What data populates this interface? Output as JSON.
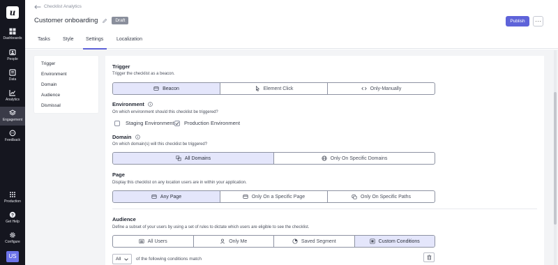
{
  "sidebar": {
    "logo": "u",
    "items": [
      {
        "label": "Dashboards",
        "icon": "dashboard-grid-icon"
      },
      {
        "label": "People",
        "icon": "people-icon"
      },
      {
        "label": "Data",
        "icon": "data-icon"
      },
      {
        "label": "Analytics",
        "icon": "analytics-chart-icon"
      },
      {
        "label": "Engagement",
        "icon": "engagement-layers-icon"
      },
      {
        "label": "Feedback",
        "icon": "feedback-chat-icon"
      },
      {
        "label": "Production",
        "icon": "production-grid-icon"
      },
      {
        "label": "Get Help",
        "icon": "help-icon"
      },
      {
        "label": "Configure",
        "icon": "gear-icon"
      }
    ],
    "active": "Engagement",
    "avatar": "US"
  },
  "header": {
    "back_label": "Checklist Analytics",
    "title": "Customer onboarding",
    "status": "Draft",
    "publish_label": "Publish"
  },
  "tabs": [
    {
      "label": "Tasks"
    },
    {
      "label": "Style"
    },
    {
      "label": "Settings"
    },
    {
      "label": "Localization"
    }
  ],
  "active_tab": "Settings",
  "subnav": [
    "Trigger",
    "Environment",
    "Domain",
    "Audience",
    "Dismissal"
  ],
  "sections": {
    "trigger": {
      "title": "Trigger",
      "subtitle": "Trigger the checklist as a beacon.",
      "options": [
        "Beacon",
        "Element Click",
        "Only-Manually"
      ],
      "selected": "Beacon"
    },
    "environment": {
      "title": "Environment",
      "subtitle": "On which environment should this checklist be triggered?",
      "options": [
        {
          "label": "Staging Environment",
          "checked": false
        },
        {
          "label": "Production Environment",
          "checked": true
        }
      ]
    },
    "domain": {
      "title": "Domain",
      "subtitle": "On which domain(s) will this checklist be triggered?",
      "options": [
        "All Domains",
        "Only On Specific Domains"
      ],
      "selected": "All Domains"
    },
    "page": {
      "title": "Page",
      "subtitle": "Display this checklist on any location users are in within your application.",
      "options": [
        "Any Page",
        "Only On a Specific Page",
        "Only On Specific Paths"
      ],
      "selected": "Any Page"
    },
    "audience": {
      "title": "Audience",
      "subtitle": "Define a subset of your users by using a set of rules to dictate which users are eligible to see the checklist.",
      "options": [
        "All Users",
        "Only Me",
        "Saved Segment",
        "Custom Conditions"
      ],
      "selected": "Custom Conditions",
      "match_value": "All",
      "match_text": "of the following conditions match"
    }
  },
  "colors": {
    "accent": "#5e63d9",
    "sidebar_bg": "#15161f",
    "selected_option_bg": "#e4e6fb"
  }
}
